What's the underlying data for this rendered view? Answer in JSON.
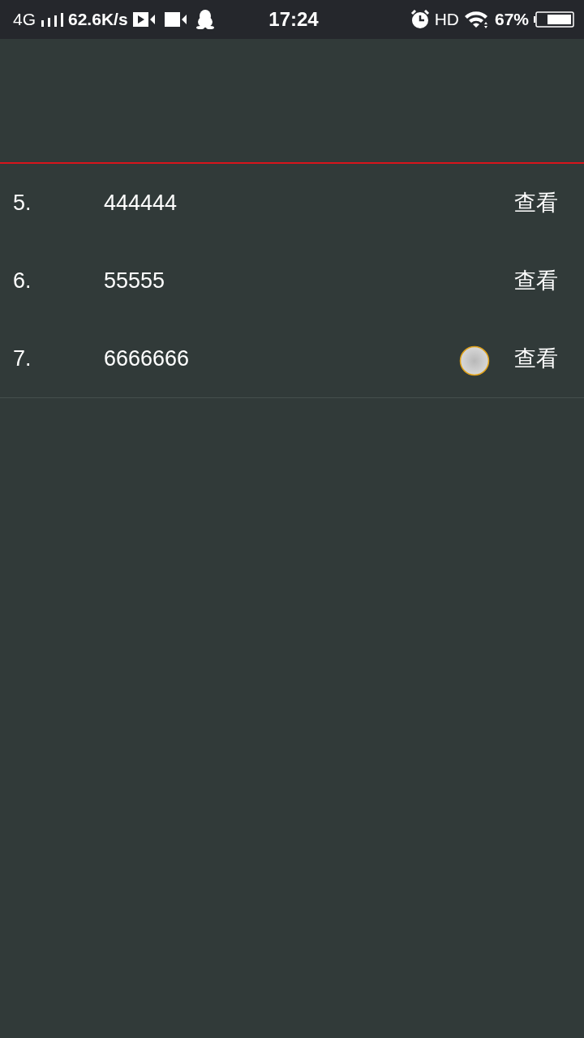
{
  "status_bar": {
    "network": "4G",
    "speed": "62.6K/s",
    "time": "17:24",
    "hd": "HD",
    "battery": "67%"
  },
  "rows": [
    {
      "index": "5.",
      "value": "444444",
      "action": "查看"
    },
    {
      "index": "6.",
      "value": "55555",
      "action": "查看"
    },
    {
      "index": "7.",
      "value": "6666666",
      "action": "查看"
    }
  ]
}
